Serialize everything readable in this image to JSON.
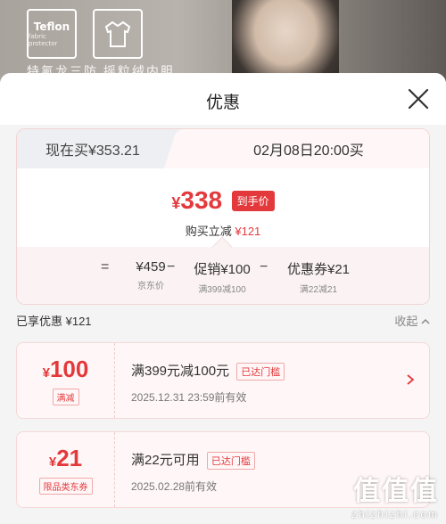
{
  "background": {
    "box1_title": "Teflon",
    "box1_sub": "fabric protector",
    "caption": "特氟龙三防   摇粒绒内胆"
  },
  "sheet": {
    "title": "优惠"
  },
  "price_card": {
    "tab_now": "现在买¥353.21",
    "tab_future": "02月08日20:00买",
    "yen": "¥",
    "price": "338",
    "price_tag": "到手价",
    "sub_text": "购买立减",
    "sub_amount": "¥121",
    "breakdown": [
      {
        "op": "=",
        "value": "¥459",
        "label": "京东价"
      },
      {
        "op": "−",
        "value": "促销¥100",
        "label": "满399减100"
      },
      {
        "op": "−",
        "value": "优惠券¥21",
        "label": "满22减21"
      }
    ]
  },
  "shared": {
    "label": "已享优惠 ¥121",
    "collapse": "收起"
  },
  "coupons": [
    {
      "yen": "¥",
      "amount": "100",
      "tag": "满减",
      "title": "满399元减100元",
      "badge": "已达门槛",
      "expiry": "2025.12.31  23:59前有效"
    },
    {
      "yen": "¥",
      "amount": "21",
      "tag": "限品类东券",
      "title": "满22元可用",
      "badge": "已达门槛",
      "expiry": "2025.02.28前有效"
    }
  ],
  "watermark": {
    "big": "值值值",
    "url": "zhizhizhi.com"
  },
  "colors": {
    "accent": "#e4393c"
  }
}
